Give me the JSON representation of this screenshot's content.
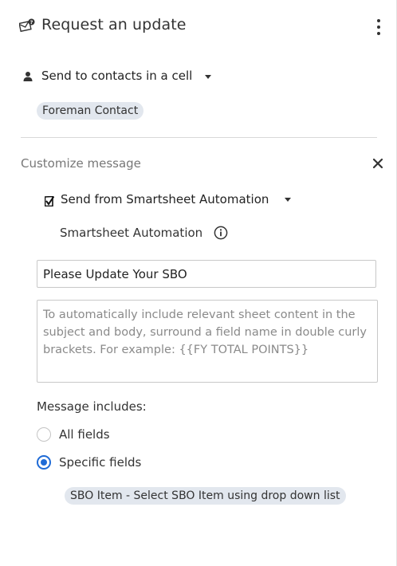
{
  "header": {
    "title": "Request an update",
    "icon": "mail-notification-icon",
    "menu_icon": "more-vertical-icon"
  },
  "recipients": {
    "label": "Send to contacts in a cell",
    "icon": "person-icon",
    "chips": [
      "Foreman Contact"
    ]
  },
  "customize": {
    "label": "Customize message",
    "close_icon": "close-icon",
    "send_from": {
      "label": "Send from Smartsheet Automation",
      "icon": "smartsheet-check-icon"
    },
    "sender_name": "Smartsheet Automation",
    "info_icon": "info-icon",
    "subject": {
      "value": "Please Update Your SBO"
    },
    "body": {
      "value": "",
      "placeholder": "To automatically include relevant sheet content in the subject and body, surround a field name in double curly brackets. For example: {{FY TOTAL POINTS}}"
    }
  },
  "includes": {
    "label": "Message includes:",
    "options": [
      {
        "label": "All fields",
        "selected": false
      },
      {
        "label": "Specific fields",
        "selected": true
      }
    ],
    "fields": [
      "SBO Item - Select SBO Item using drop down list"
    ]
  },
  "colors": {
    "accent": "#1f6bd6",
    "chip_bg": "#e2e7ee",
    "muted_text": "#777777"
  }
}
